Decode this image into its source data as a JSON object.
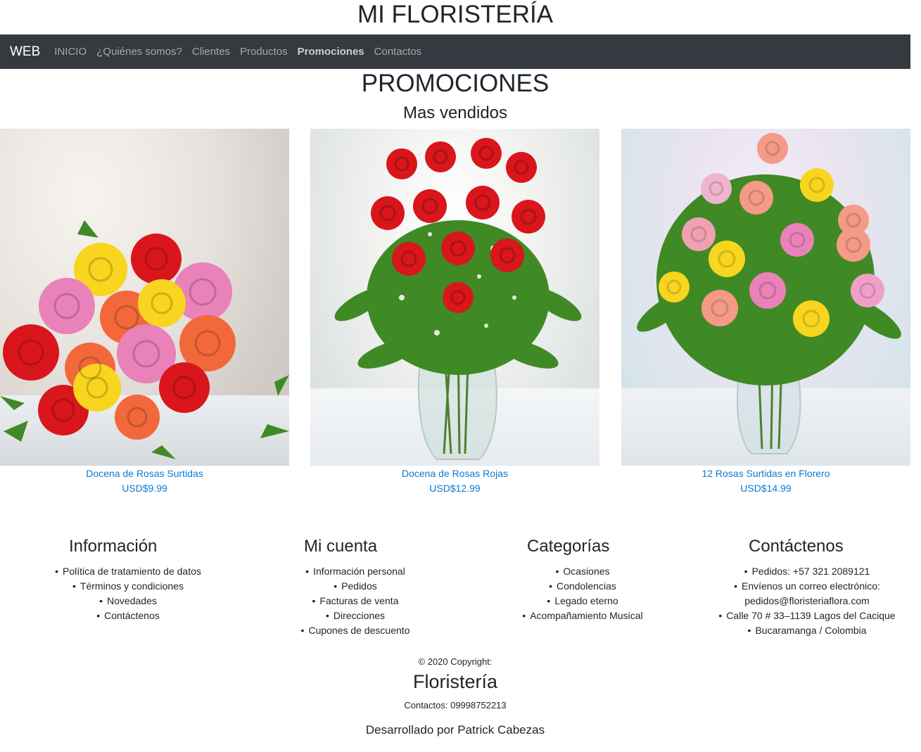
{
  "header": {
    "site_title": "MI FLORISTERÍA"
  },
  "navbar": {
    "brand": "WEB",
    "links": [
      {
        "label": "INICIO"
      },
      {
        "label": "¿Quiénes somos?"
      },
      {
        "label": "Clientes"
      },
      {
        "label": "Productos"
      },
      {
        "label": "Promociones",
        "active": true
      },
      {
        "label": "Contactos"
      }
    ]
  },
  "main": {
    "title": "PROMOCIONES",
    "subtitle": "Mas vendidos",
    "products": [
      {
        "name": "Docena de Rosas Surtidas",
        "price": "USD$9.99"
      },
      {
        "name": "Docena de Rosas Rojas",
        "price": "USD$12.99"
      },
      {
        "name": "12 Rosas Surtidas en Florero",
        "price": "USD$14.99"
      }
    ]
  },
  "footer": {
    "columns": [
      {
        "title": "Información",
        "items": [
          "Política de tratamiento de datos",
          "Términos y condiciones",
          "Novedades",
          "Contáctenos"
        ]
      },
      {
        "title": "Mi cuenta",
        "items": [
          "Información personal",
          "Pedidos",
          "Facturas de venta",
          "Direcciones",
          "Cupones de descuento"
        ]
      },
      {
        "title": "Categorías",
        "items": [
          "Ocasiones",
          "Condolencias",
          "Legado eterno",
          "Acompañamiento Musical"
        ]
      },
      {
        "title": "Contáctenos",
        "items": [
          "Pedidos: +57 321 2089121",
          "Envíenos un correo electrónico:",
          "pedidos@floristeriaflora.com",
          "Calle 70 # 33–1139 Lagos del Cacique",
          "Bucaramanga / Colombia"
        ]
      }
    ],
    "copyright": "© 2020 Copyright:",
    "brand": "Floristería",
    "contacts": "Contactos: 09998752213",
    "developer": "Desarrollado por Patrick Cabezas"
  },
  "colors": {
    "navbar_bg": "#343a40",
    "link": "#0a7ad7",
    "rose_red": "#d8161c",
    "rose_yellow": "#f8d51e",
    "rose_pink": "#e882b9",
    "rose_orange": "#f2683a",
    "rose_coral": "#f59a86",
    "leaf_green": "#3f8a25"
  }
}
